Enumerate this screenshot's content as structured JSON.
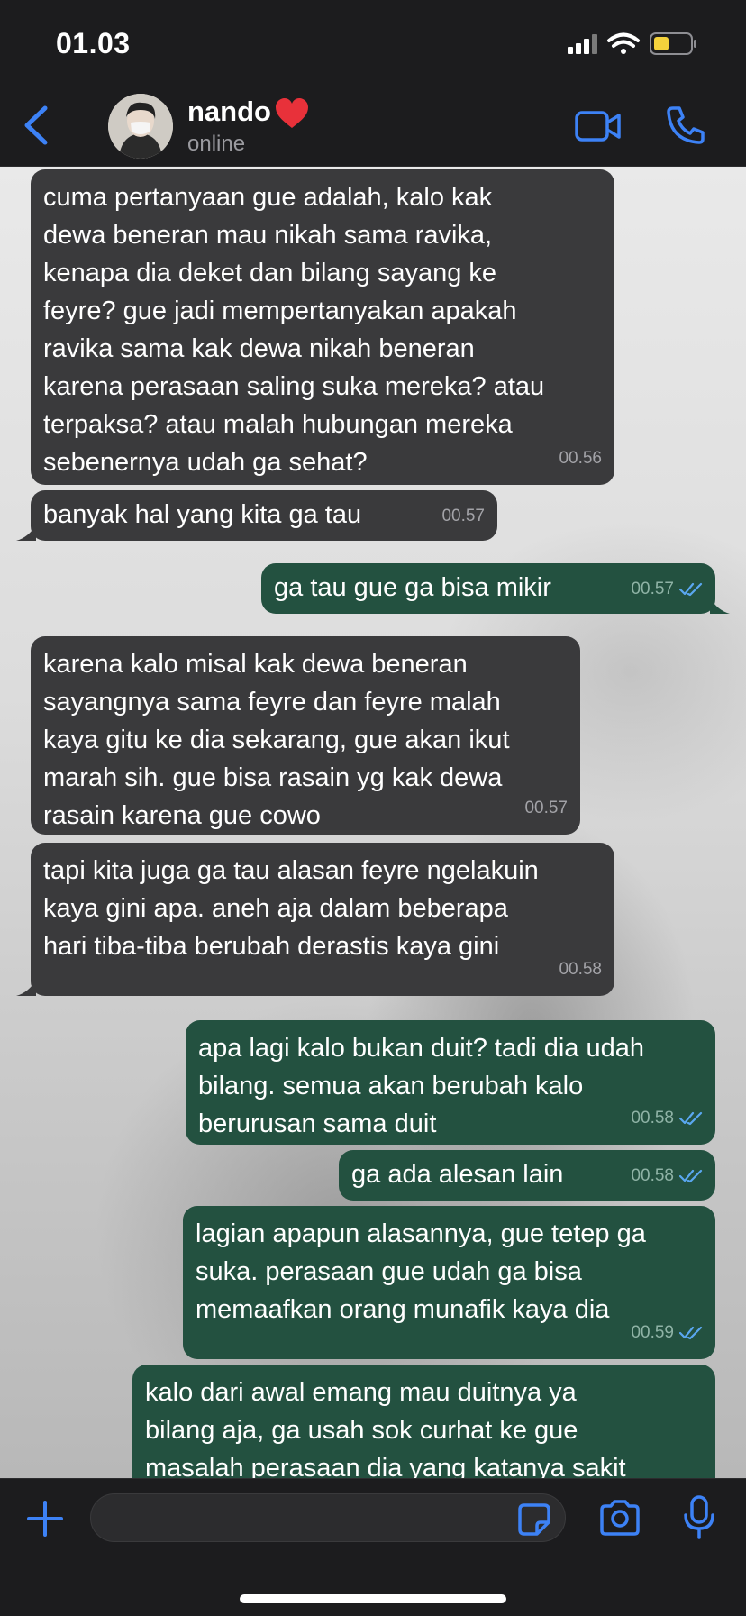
{
  "status_bar": {
    "time": "01.03"
  },
  "header": {
    "contact_name": "nando",
    "contact_status": "online"
  },
  "messages": [
    {
      "direction": "in",
      "text": "cuma pertanyaan gue adalah, kalo kak\ndewa beneran mau nikah sama ravika,\nkenapa dia deket dan bilang sayang ke\nfeyre? gue jadi mempertanyakan apakah\nravika sama kak dewa nikah beneran\nkarena perasaan saling suka mereka? atau\nterpaksa? atau malah hubungan mereka\nsebenernya udah ga sehat?",
      "time": "00.56"
    },
    {
      "direction": "in",
      "text": "banyak hal yang kita ga tau",
      "time": "00.57"
    },
    {
      "direction": "out",
      "text": "ga tau gue ga bisa mikir",
      "time": "00.57",
      "read": true
    },
    {
      "direction": "in",
      "text": "karena kalo misal kak dewa beneran\nsayangnya sama feyre dan feyre malah\nkaya gitu ke dia sekarang, gue akan ikut\nmarah sih. gue bisa rasain yg kak dewa\nrasain karena gue cowo",
      "time": "00.57"
    },
    {
      "direction": "in",
      "text": "tapi kita juga ga tau alasan feyre ngelakuin\nkaya gini apa. aneh aja dalam beberapa\nhari tiba-tiba berubah derastis kaya gini",
      "time": "00.58"
    },
    {
      "direction": "out",
      "text": "apa lagi kalo bukan duit? tadi dia udah\nbilang. semua akan berubah kalo\nberurusan sama duit",
      "time": "00.58",
      "read": true
    },
    {
      "direction": "out",
      "text": "ga ada alesan lain",
      "time": "00.58",
      "read": true
    },
    {
      "direction": "out",
      "text": "lagian apapun alasannya, gue tetep ga\nsuka. perasaan gue udah ga bisa\nmemaafkan orang munafik kaya dia",
      "time": "00.59",
      "read": true
    },
    {
      "direction": "out",
      "text": "kalo dari awal emang mau duitnya ya\nbilang aja, ga usah sok curhat ke gue\nmasalah perasaan dia yang katanya sakit",
      "time": "",
      "read": false
    }
  ],
  "composer": {
    "placeholder": ""
  },
  "colors": {
    "incoming_bubble": "#3a3a3c",
    "outgoing_bubble": "#235140",
    "accent": "#3d82f6",
    "read_tick": "#5aa7f0"
  },
  "icons": [
    "back-chevron-icon",
    "heart-emoji",
    "video-call-icon",
    "phone-icon",
    "plus-icon",
    "sticker-icon",
    "camera-icon",
    "microphone-icon",
    "read-receipt-icon",
    "signal-icon",
    "wifi-icon",
    "battery-icon"
  ]
}
